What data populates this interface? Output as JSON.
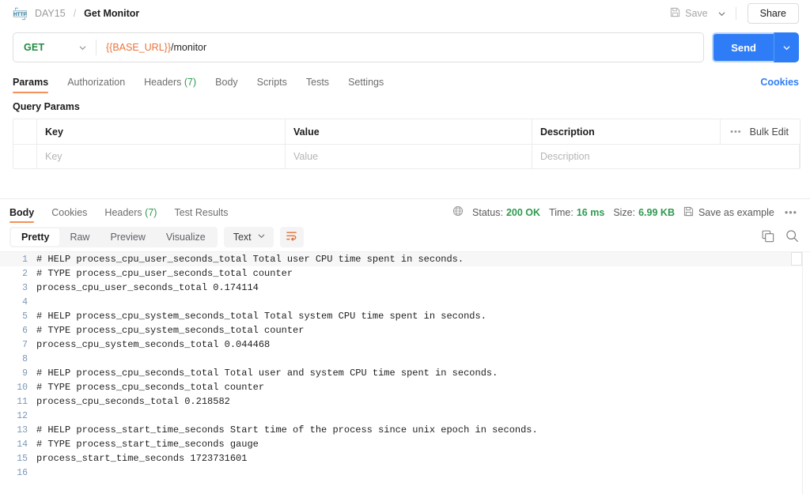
{
  "header": {
    "icon": "http-badge-icon",
    "breadcrumb_parent": "DAY15",
    "breadcrumb_separator": "/",
    "breadcrumb_current": "Get Monitor",
    "save_label": "Save",
    "save_icon": "floppy-disk-icon",
    "save_caret_icon": "chevron-down-icon",
    "share_label": "Share"
  },
  "request": {
    "method": "GET",
    "method_caret_icon": "chevron-down-icon",
    "url_variable": "{{BASE_URL}}",
    "url_path": "/monitor",
    "send_label": "Send",
    "send_caret_icon": "chevron-down-icon",
    "tabs": [
      {
        "label": "Params",
        "count": "",
        "active": true
      },
      {
        "label": "Authorization",
        "count": "",
        "active": false
      },
      {
        "label": "Headers",
        "count": "(7)",
        "active": false
      },
      {
        "label": "Body",
        "count": "",
        "active": false
      },
      {
        "label": "Scripts",
        "count": "",
        "active": false
      },
      {
        "label": "Tests",
        "count": "",
        "active": false
      },
      {
        "label": "Settings",
        "count": "",
        "active": false
      }
    ],
    "cookies_link": "Cookies"
  },
  "query_params": {
    "title": "Query Params",
    "columns": [
      "Key",
      "Value",
      "Description"
    ],
    "placeholder_row": [
      "Key",
      "Value",
      "Description"
    ],
    "bulk_edit_label": "Bulk Edit",
    "bulk_dots_icon": "more-horizontal-icon"
  },
  "response": {
    "tabs": [
      {
        "label": "Body",
        "count": "",
        "active": true
      },
      {
        "label": "Cookies",
        "count": "",
        "active": false
      },
      {
        "label": "Headers",
        "count": "(7)",
        "active": false
      },
      {
        "label": "Test Results",
        "count": "",
        "active": false
      }
    ],
    "globe_icon": "globe-icon",
    "status_label": "Status:",
    "status_value": "200 OK",
    "time_label": "Time:",
    "time_value": "16 ms",
    "size_label": "Size:",
    "size_value": "6.99 KB",
    "save_example_label": "Save as example",
    "save_example_icon": "floppy-disk-icon",
    "more_icon": "more-horizontal-icon",
    "view_modes": [
      {
        "label": "Pretty",
        "active": true
      },
      {
        "label": "Raw",
        "active": false
      },
      {
        "label": "Preview",
        "active": false
      },
      {
        "label": "Visualize",
        "active": false
      }
    ],
    "format": "Text",
    "format_caret_icon": "chevron-down-icon",
    "wrap_icon": "wrap-text-icon",
    "copy_icon": "copy-icon",
    "search_icon": "search-icon"
  },
  "body_lines": [
    {
      "n": "1",
      "text": "# HELP process_cpu_user_seconds_total Total user CPU time spent in seconds."
    },
    {
      "n": "2",
      "text": "# TYPE process_cpu_user_seconds_total counter"
    },
    {
      "n": "3",
      "text": "process_cpu_user_seconds_total 0.174114"
    },
    {
      "n": "4",
      "text": ""
    },
    {
      "n": "5",
      "text": "# HELP process_cpu_system_seconds_total Total system CPU time spent in seconds."
    },
    {
      "n": "6",
      "text": "# TYPE process_cpu_system_seconds_total counter"
    },
    {
      "n": "7",
      "text": "process_cpu_system_seconds_total 0.044468"
    },
    {
      "n": "8",
      "text": ""
    },
    {
      "n": "9",
      "text": "# HELP process_cpu_seconds_total Total user and system CPU time spent in seconds."
    },
    {
      "n": "10",
      "text": "# TYPE process_cpu_seconds_total counter"
    },
    {
      "n": "11",
      "text": "process_cpu_seconds_total 0.218582"
    },
    {
      "n": "12",
      "text": ""
    },
    {
      "n": "13",
      "text": "# HELP process_start_time_seconds Start time of the process since unix epoch in seconds."
    },
    {
      "n": "14",
      "text": "# TYPE process_start_time_seconds gauge"
    },
    {
      "n": "15",
      "text": "process_start_time_seconds 1723731601"
    },
    {
      "n": "16",
      "text": ""
    }
  ],
  "colors": {
    "accent_blue": "#2f7df6",
    "method_green": "#1d8a3f",
    "status_green": "#2d9a4e",
    "tab_underline": "#f2915a",
    "url_variable": "#e8743b"
  }
}
